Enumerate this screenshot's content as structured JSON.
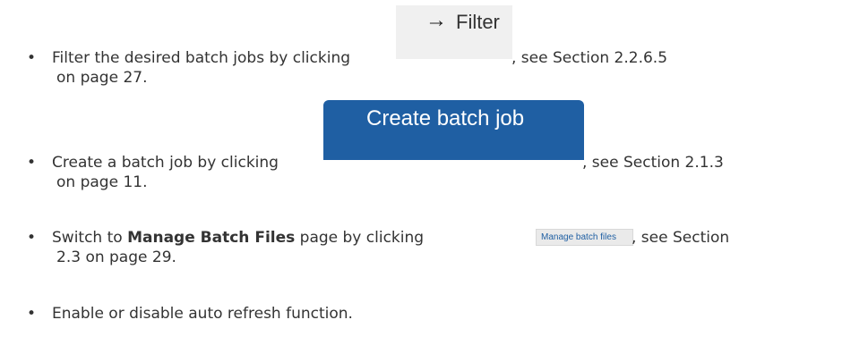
{
  "bullets": [
    {
      "marker": "•",
      "text_before": "Filter the desired batch jobs by clicking",
      "button_arrow": "→",
      "button_label": "Filter",
      "text_after": ", see Section 2.2.6.5",
      "continuation": "on page 27."
    },
    {
      "marker": "•",
      "text_before": "Create a batch job by clicking",
      "button_label": "Create batch job",
      "text_after": ", see Section 2.1.3",
      "continuation": "on page 11."
    },
    {
      "marker": "•",
      "text_before": "Switch to",
      "bold_text": "Manage Batch Files",
      "text_middle": "page by clicking",
      "button_label": "Manage batch files",
      "text_after": ", see Section",
      "continuation": "2.3 on page 29."
    },
    {
      "marker": "•",
      "text_before": "Enable or disable auto refresh function."
    }
  ],
  "colors": {
    "body_text": "#333333",
    "primary_button_bg": "#1f5fa3",
    "filter_button_bg": "#f0f0f0",
    "small_button_text": "#1f5fa3"
  }
}
